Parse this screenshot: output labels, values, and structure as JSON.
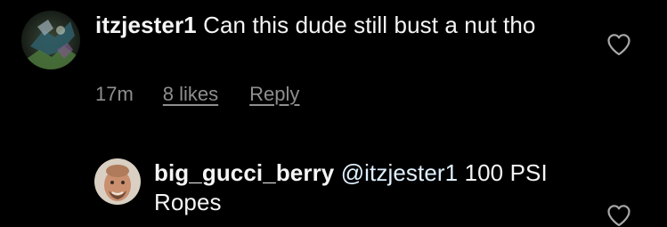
{
  "comments": [
    {
      "username": "itzjester1",
      "text": "Can this dude still bust a nut tho",
      "time": "17m",
      "likes": "8 likes",
      "reply": "Reply",
      "avatar_icon": "abstract-avatar",
      "like_icon": "heart-outline-icon"
    },
    {
      "username": "big_gucci_berry",
      "mention": "@itzjester1",
      "text": "100 PSI Ropes",
      "avatar_icon": "profile-photo-avatar",
      "like_icon": "heart-outline-icon"
    }
  ],
  "colors": {
    "background": "#000000",
    "text": "#f5f5f5",
    "meta": "#8e8e8e",
    "mention": "#e0f1ff"
  }
}
